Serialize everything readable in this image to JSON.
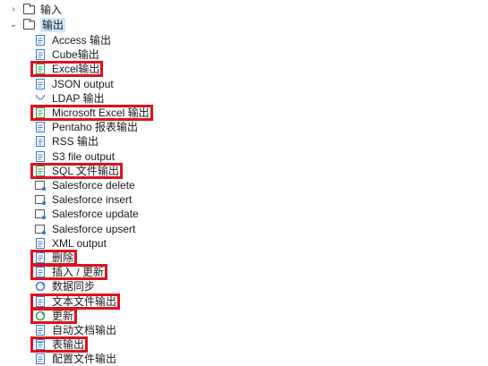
{
  "tree": {
    "folders": [
      {
        "label": "输入",
        "expanded": false
      },
      {
        "label": "输出",
        "expanded": true
      }
    ],
    "toggles": {
      "collapsed": "›",
      "expanded": "⌄"
    },
    "items": [
      {
        "label": "Access 输出",
        "icon": "db-output-icon",
        "color": "#3a7bd5"
      },
      {
        "label": "Cube输出",
        "icon": "file-output-icon",
        "color": "#3a7bd5"
      },
      {
        "label": "Excel输出",
        "icon": "excel-output-icon",
        "color": "#2e9b4e",
        "highlighted": true
      },
      {
        "label": "JSON output",
        "icon": "json-output-icon",
        "color": "#3a7bd5"
      },
      {
        "label": "LDAP 输出",
        "icon": "ldap-output-icon",
        "color": "#3a7bd5"
      },
      {
        "label": "Microsoft Excel 输出",
        "icon": "excel-output-icon",
        "color": "#2e9b4e",
        "highlighted": true
      },
      {
        "label": "Pentaho 报表输出",
        "icon": "report-output-icon",
        "color": "#3a7bd5"
      },
      {
        "label": "RSS 输出",
        "icon": "rss-output-icon",
        "color": "#3a7bd5"
      },
      {
        "label": "S3 file output",
        "icon": "file-output-icon",
        "color": "#3a7bd5"
      },
      {
        "label": "SQL 文件输出",
        "icon": "sql-output-icon",
        "color": "#2e9b4e",
        "highlighted": true
      },
      {
        "label": "Salesforce delete",
        "icon": "salesforce-icon",
        "color": "#3a7bd5"
      },
      {
        "label": "Salesforce insert",
        "icon": "salesforce-icon",
        "color": "#3a7bd5"
      },
      {
        "label": "Salesforce update",
        "icon": "salesforce-icon",
        "color": "#3a7bd5"
      },
      {
        "label": "Salesforce upsert",
        "icon": "salesforce-icon",
        "color": "#3a7bd5"
      },
      {
        "label": "XML output",
        "icon": "xml-output-icon",
        "color": "#3a7bd5"
      },
      {
        "label": "删除",
        "icon": "delete-icon",
        "color": "#3a7bd5",
        "highlighted": true
      },
      {
        "label": "插入 / 更新",
        "icon": "insert-update-icon",
        "color": "#3a7bd5",
        "highlighted": true
      },
      {
        "label": "数据同步",
        "icon": "sync-icon",
        "color": "#3a7bd5"
      },
      {
        "label": "文本文件输出",
        "icon": "text-output-icon",
        "color": "#3a7bd5",
        "highlighted": true
      },
      {
        "label": "更新",
        "icon": "update-icon",
        "color": "#2e9b4e",
        "highlighted": true
      },
      {
        "label": "自动文档输出",
        "icon": "autodoc-icon",
        "color": "#3a7bd5"
      },
      {
        "label": "表输出",
        "icon": "table-output-icon",
        "color": "#3a7bd5",
        "highlighted": true
      },
      {
        "label": "配置文件输出",
        "icon": "config-output-icon",
        "color": "#3a7bd5"
      }
    ]
  },
  "colors": {
    "highlight": "#e0101e",
    "selection": "#cce8ff"
  }
}
